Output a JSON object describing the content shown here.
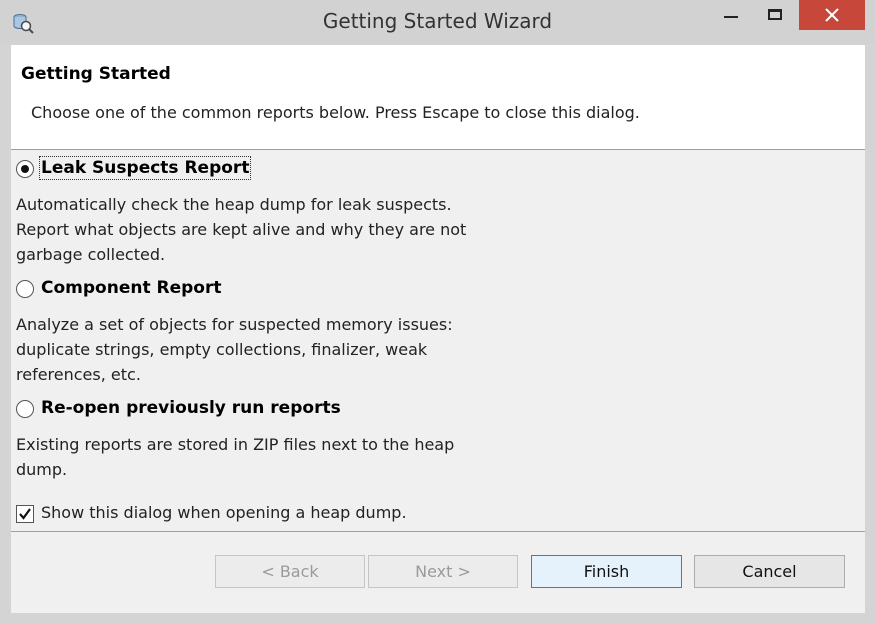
{
  "window": {
    "title": "Getting Started Wizard",
    "icon": "heap-analyzer-icon",
    "controls": [
      "minimize-icon",
      "maximize-icon",
      "close-icon"
    ]
  },
  "header": {
    "title": "Getting Started",
    "description": "Choose one of the common reports below. Press Escape to close this dialog."
  },
  "options": [
    {
      "label": "Leak Suspects Report",
      "selected": true,
      "description": "Automatically check the heap dump for leak suspects. Report what objects are kept alive and why they are not garbage collected."
    },
    {
      "label": "Component Report",
      "selected": false,
      "description": "Analyze a set of objects for suspected memory issues: duplicate strings, empty collections, finalizer, weak references, etc."
    },
    {
      "label": "Re-open previously run reports",
      "selected": false,
      "description": "Existing reports are stored in ZIP files next to the heap dump."
    }
  ],
  "show_dialog": {
    "label": "Show this dialog when opening a heap dump.",
    "checked": true
  },
  "buttons": {
    "back": "< Back",
    "next": "Next >",
    "finish": "Finish",
    "cancel": "Cancel"
  },
  "colors": {
    "close_button": "#c7483b",
    "default_button_border": "#3c7fb1"
  }
}
